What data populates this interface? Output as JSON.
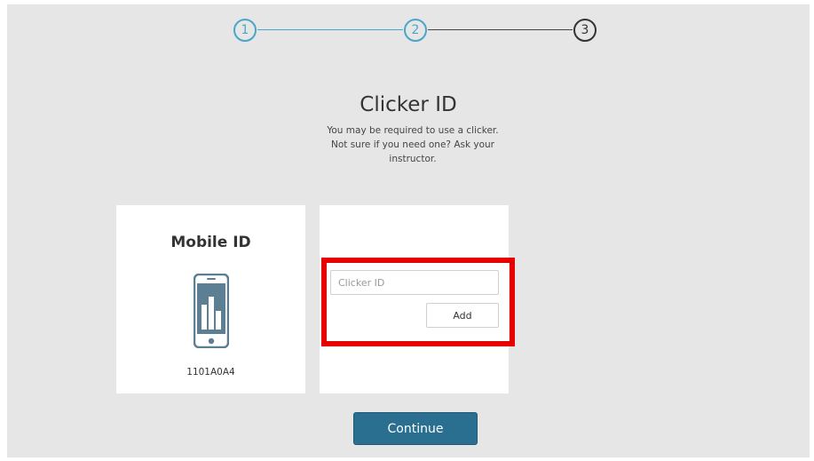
{
  "stepper": {
    "steps": [
      {
        "label": "1",
        "state": "completed"
      },
      {
        "label": "2",
        "state": "completed"
      },
      {
        "label": "3",
        "state": "current"
      }
    ],
    "colors": {
      "completed": "#4aa6c9",
      "current": "#333333"
    }
  },
  "header": {
    "title": "Clicker ID",
    "subtitle": "You may be required to use a clicker. Not sure if you need one? Ask your instructor."
  },
  "mobile_card": {
    "heading": "Mobile ID",
    "icon": "smartphone-chart-icon",
    "mobile_id": "1101A0A4"
  },
  "clicker_card": {
    "input_placeholder": "Clicker ID",
    "input_value": "",
    "add_label": "Add"
  },
  "highlight": {
    "color": "#e60000"
  },
  "footer": {
    "continue_label": "Continue",
    "continue_color": "#2a6f8f"
  }
}
